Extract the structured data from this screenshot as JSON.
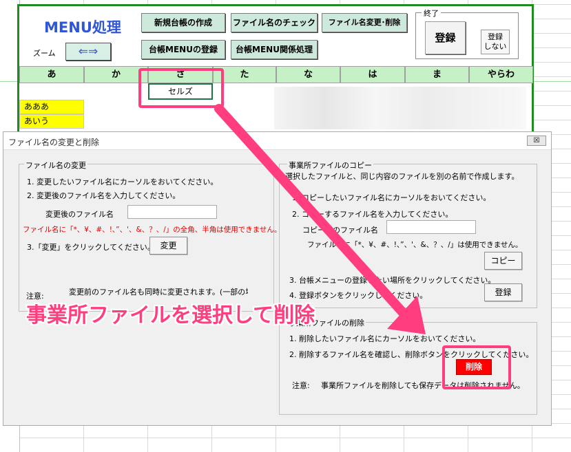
{
  "menu": {
    "title": "MENU処理",
    "zoom_label": "ズーム",
    "zoom_button": "⇐⇒",
    "buttons": {
      "new_ledger": "新規台帳の作成",
      "filename_check": "ファイル名のチェック",
      "filename_change_delete": "ファイル名変更･削除",
      "ledger_menu_register": "台帳MENUの登録",
      "ledger_menu_related": "台帳MENU関係処理"
    },
    "end_group": {
      "legend": "終了",
      "register": "登録",
      "no_register_line1": "登録",
      "no_register_line2": "しない"
    }
  },
  "sheet": {
    "headers": [
      "あ",
      "か",
      "さ",
      "た",
      "な",
      "は",
      "ま",
      "やらわ"
    ],
    "selected_cell": "セルズ",
    "rows": [
      "あああ",
      "あいう"
    ]
  },
  "dialog": {
    "title": "ファイル名の変更と削除",
    "close": "☒",
    "rename": {
      "legend": "ファイル名の変更",
      "step1": "1. 変更したいファイル名にカーソルをおいてください。",
      "step2": "2. 変更後のファイル名を入力してください。",
      "new_name_label": "変更後のファイル名",
      "new_name_value": "",
      "warning": "ファイル名に「*、¥、#、!、”、'、&、？、/」の全角、半角は使用できません。",
      "step3": "3.「変更」をクリックしてください。",
      "change_button": "変更",
      "note_label": "注意:",
      "note_text": "変更前のファイル名も同時に変更されます。(一部の場合)"
    },
    "copy": {
      "legend": "事業所ファイルのコピー",
      "desc": "選択したファイルと、同じ内容のファイルを別の名前で作成します。",
      "step1": "1. コピーしたいファイル名にカーソルをおいてください。",
      "step2": "2. コピーするファイル名を入力してください。",
      "copy_name_label": "コピー後のファイル名",
      "copy_name_value": "",
      "warning": "ファイル名に「*、¥、#、!、”、'、&、？、/」は使用できません。",
      "copy_button": "コピー",
      "step3": "3. 台帳メニューの登録したい場所をクリックしてください。",
      "step4": "4. 登録ボタンをクリックしてください。",
      "register_button": "登録"
    },
    "delete": {
      "legend": "事業所ファイルの削除",
      "step1": "1. 削除したいファイル名にカーソルをおいてください。",
      "step2": "2. 削除するファイル名を確認し、削除ボタンをクリックしてください。",
      "delete_button": "削除",
      "note_label": "注意:",
      "note_text": "事業所ファイルを削除しても保存データは削除されません。"
    }
  },
  "annotation": {
    "caption": "事業所ファイルを選択して削除",
    "color": "#ff3d7f"
  }
}
